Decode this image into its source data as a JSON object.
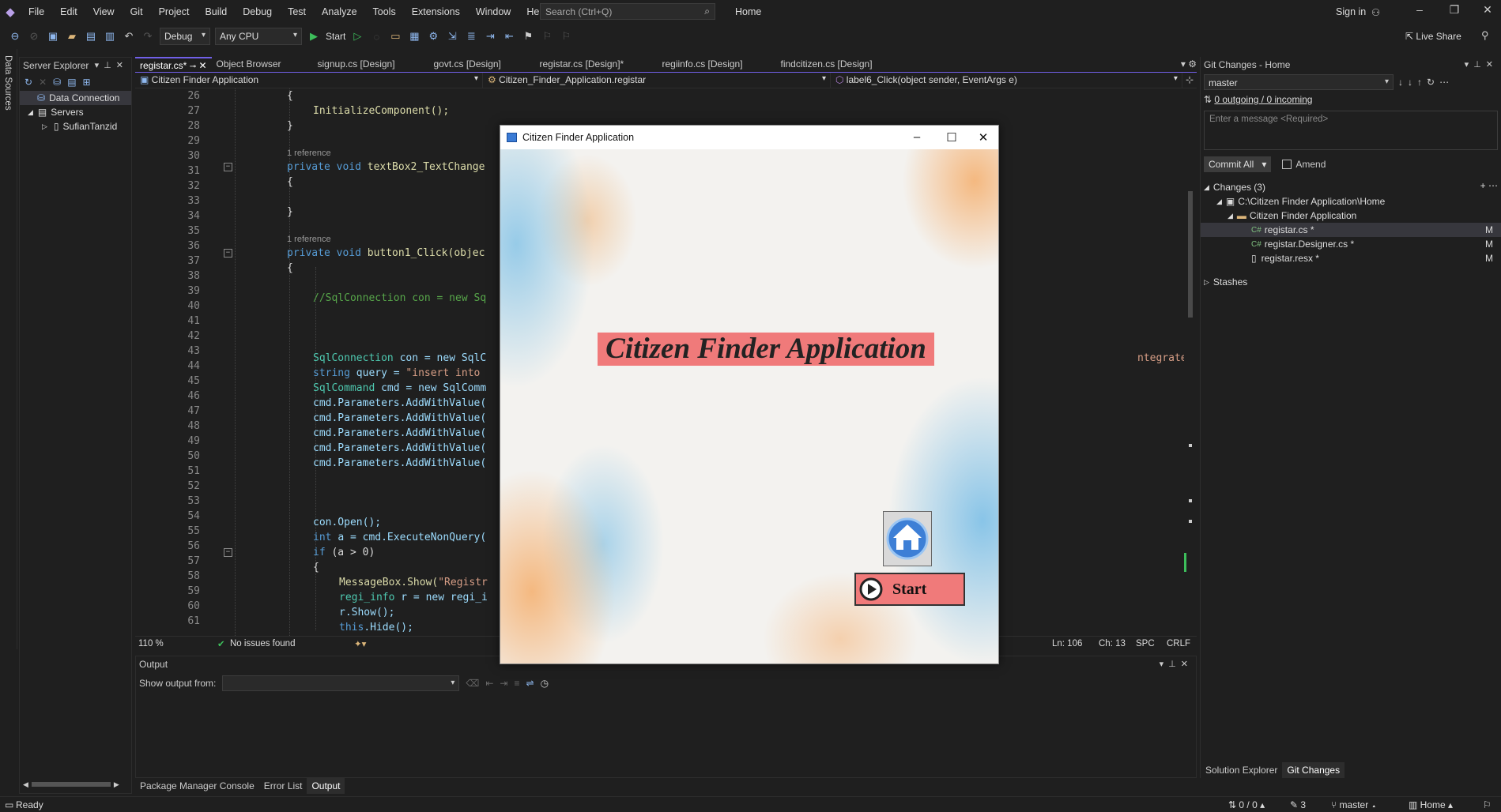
{
  "menu": [
    "File",
    "Edit",
    "View",
    "Git",
    "Project",
    "Build",
    "Debug",
    "Test",
    "Analyze",
    "Tools",
    "Extensions",
    "Window",
    "Help"
  ],
  "search_placeholder": "Search (Ctrl+Q)",
  "solution_name": "Home",
  "sign_in": "Sign in",
  "live_share": "Live Share",
  "toolbar": {
    "config": "Debug",
    "platform": "Any CPU",
    "start": "Start"
  },
  "side_tab": "Data Sources",
  "server_explorer": {
    "title": "Server Explorer",
    "items": [
      "Data Connection",
      "Servers",
      "SufianTanzid"
    ]
  },
  "doc_tabs": [
    "registar.cs*",
    "Object Browser",
    "signup.cs [Design]",
    "govt.cs [Design]",
    "registar.cs [Design]*",
    "regiinfo.cs [Design]",
    "findcitizen.cs [Design]"
  ],
  "navbar": {
    "project": "Citizen Finder Application",
    "class": "Citizen_Finder_Application.registar",
    "member": "label6_Click(object sender, EventArgs e)"
  },
  "code": {
    "l26": "{",
    "l27": "InitializeComponent();",
    "l28": "}",
    "ref": "1 reference",
    "l30_kw": "private void",
    "l30_fn": "textBox2_TextChange",
    "l35_fn": "button1_Click(objec",
    "l38": "//SqlConnection con = new Sq",
    "l42_ty": "SqlConnection",
    "l42_rest": "con = new SqlC",
    "l42_tail": "ntegrated Security=True\");",
    "l43_kw": "string",
    "l43_rest": "query = ",
    "l43_str": "\"insert into ",
    "l44_ty": "SqlCommand",
    "l44_rest": "cmd = new SqlComm",
    "l45": "cmd.Parameters.AddWithValue(",
    "l53": "con.Open();",
    "l54_kw": "int",
    "l54_rest": "a = cmd.ExecuteNonQuery(",
    "l55_kw": "if",
    "l55_rest": "(a > 0)",
    "l56": "{",
    "l57_fn": "MessageBox.Show(",
    "l57_str": "\"Registr",
    "l58_ty": "regi_info",
    "l58_rest": "r = new regi_i",
    "l59": "r.Show();",
    "l60_kw": "this",
    "l60_rest": ".Hide();"
  },
  "line_numbers": [
    "26",
    "27",
    "28",
    "29",
    "30",
    "31",
    "32",
    "33",
    "34",
    "35",
    "36",
    "37",
    "38",
    "39",
    "40",
    "41",
    "42",
    "43",
    "44",
    "45",
    "46",
    "47",
    "48",
    "49",
    "50",
    "51",
    "52",
    "53",
    "54",
    "55",
    "56",
    "57",
    "58",
    "59",
    "60",
    "61"
  ],
  "editor_status": {
    "zoom": "110 %",
    "issues": "No issues found",
    "ln": "Ln: 106",
    "ch": "Ch: 13",
    "spc": "SPC",
    "crlf": "CRLF"
  },
  "output": {
    "title": "Output",
    "show_from": "Show output from:"
  },
  "bottom_tabs": [
    "Package Manager Console",
    "Error List",
    "Output"
  ],
  "git": {
    "title": "Git Changes - Home",
    "branch": "master",
    "sync": "0 outgoing / 0 incoming",
    "message_placeholder": "Enter a message <Required>",
    "commit": "Commit All",
    "amend": "Amend",
    "changes": "Changes (3)",
    "path": "C:\\Citizen Finder Application\\Home",
    "folder": "Citizen Finder Application",
    "files": [
      {
        "name": "registar.cs *",
        "status": "M",
        "type": "C#"
      },
      {
        "name": "registar.Designer.cs *",
        "status": "M",
        "type": "C#"
      },
      {
        "name": "registar.resx *",
        "status": "M",
        "type": ""
      }
    ],
    "stashes": "Stashes",
    "panel_tabs": [
      "Solution Explorer",
      "Git Changes"
    ]
  },
  "status": {
    "ready": "Ready",
    "sync": "0 / 0",
    "edits": "3",
    "branch": "master",
    "repo": "Home"
  },
  "dialog": {
    "title": "Citizen Finder Application",
    "heading": "Citizen Finder Application",
    "start": "Start"
  }
}
